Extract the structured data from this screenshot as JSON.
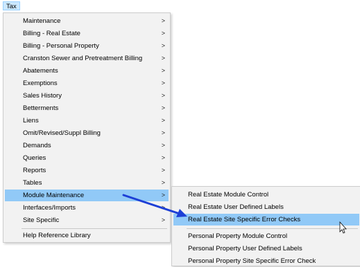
{
  "menubar": {
    "tax_label": "Tax"
  },
  "main_menu": {
    "items": [
      {
        "label": "Maintenance",
        "has_submenu": true
      },
      {
        "label": "Billing - Real Estate",
        "has_submenu": true
      },
      {
        "label": "Billing - Personal Property",
        "has_submenu": true
      },
      {
        "label": "Cranston Sewer and Pretreatment Billing",
        "has_submenu": true
      },
      {
        "label": "Abatements",
        "has_submenu": true
      },
      {
        "label": "Exemptions",
        "has_submenu": true
      },
      {
        "label": "Sales History",
        "has_submenu": true
      },
      {
        "label": "Betterments",
        "has_submenu": true
      },
      {
        "label": "Liens",
        "has_submenu": true
      },
      {
        "label": "Omit/Revised/Suppl Billing",
        "has_submenu": true
      },
      {
        "label": "Demands",
        "has_submenu": true
      },
      {
        "label": "Queries",
        "has_submenu": true
      },
      {
        "label": "Reports",
        "has_submenu": true
      },
      {
        "label": "Tables",
        "has_submenu": true
      },
      {
        "label": "Module Maintenance",
        "has_submenu": true,
        "highlighted": true
      },
      {
        "label": "Interfaces/Imports",
        "has_submenu": true
      },
      {
        "label": "Site Specific",
        "has_submenu": true
      },
      {
        "label": "Help Reference Library",
        "has_submenu": false
      }
    ],
    "arrow_glyph": ">"
  },
  "sub_menu": {
    "items": [
      {
        "label": "Real Estate Module Control"
      },
      {
        "label": "Real Estate User Defined Labels"
      },
      {
        "label": "Real Estate Site Specific Error Checks",
        "highlighted": true
      },
      {
        "label": "Personal Property Module Control"
      },
      {
        "label": "Personal Property User Defined Labels"
      },
      {
        "label": "Personal Property Site Specific Error Check"
      }
    ]
  },
  "colors": {
    "menu_bg": "#f2f2f2",
    "highlight": "#91c9f7",
    "annotation_arrow": "#1d3fd6"
  },
  "icons": {
    "annotation": "arrow-annotation-icon",
    "cursor": "mouse-cursor-icon"
  }
}
